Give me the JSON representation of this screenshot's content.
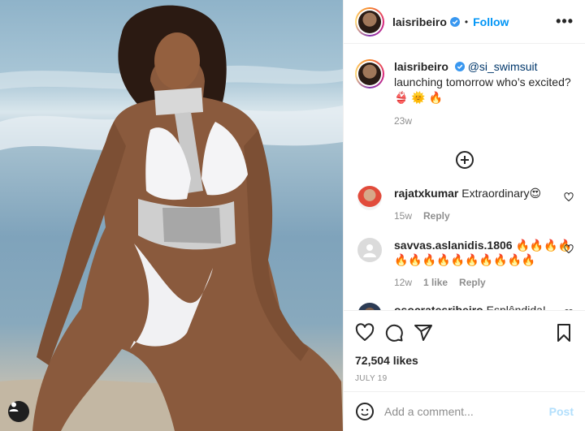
{
  "post": {
    "username": "laisribeiro",
    "follow_label": "Follow",
    "dot": "•",
    "more_label": "•••",
    "caption": {
      "author": "laisribeiro",
      "mention": "@si_swimsuit",
      "text": " launching tomorrow who’s excited? 👙 🌞 🔥",
      "time": "23w"
    },
    "comments": [
      {
        "user": "rajatxkumar",
        "text": "Extraordinary😍",
        "time": "15w",
        "likes": "",
        "reply": "Reply"
      },
      {
        "user": "savvas.aslanidis.1806",
        "text": "🔥🔥🔥🔥🔥🔥🔥🔥🔥🔥🔥🔥🔥🔥",
        "time": "12w",
        "likes": "1 like",
        "reply": "Reply"
      },
      {
        "user": "osocratesribeiro",
        "text": "Esplêndida!"
      }
    ],
    "likes": "72,504 likes",
    "date": "JULY 19",
    "comment_placeholder": "Add a comment...",
    "post_label": "Post"
  },
  "colors": {
    "accent": "#0095f6",
    "post_disabled": "#b2dffc",
    "muted": "#8e8e8e"
  },
  "icons": [
    "user-tag-icon",
    "verified-icon",
    "more-icon",
    "add-circle-icon",
    "heart-icon",
    "comment-icon",
    "share-icon",
    "bookmark-icon",
    "emoji-icon"
  ]
}
